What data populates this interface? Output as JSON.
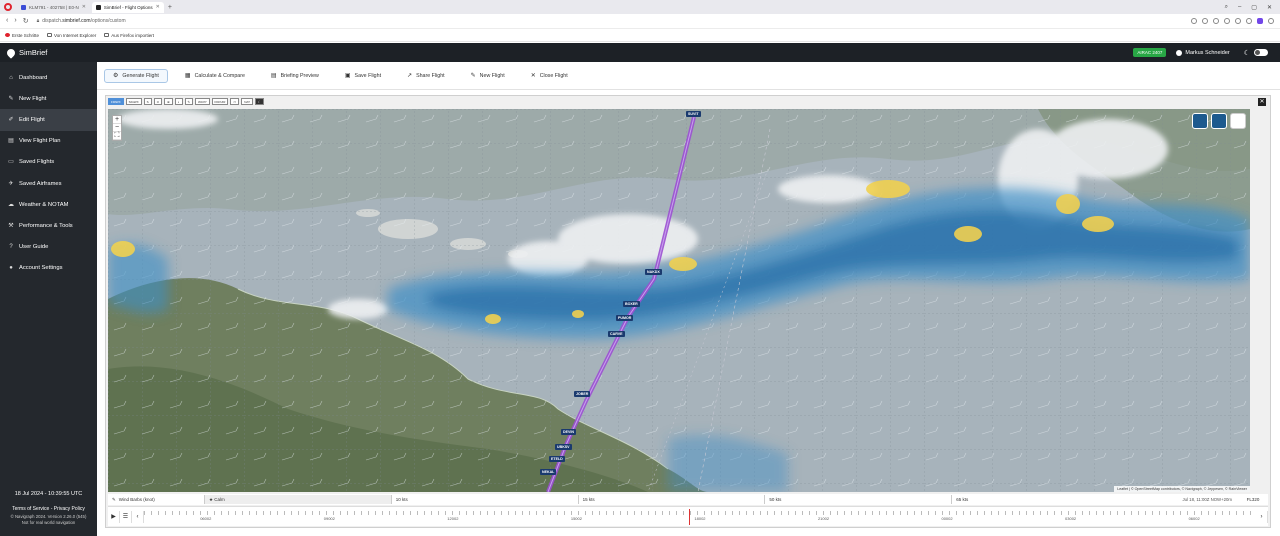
{
  "browser": {
    "tabs": [
      {
        "label": "KLM791 - 402758 | E0-N"
      },
      {
        "label": "SimBrief - Flight Options"
      }
    ],
    "url_prefix": "dispatch.",
    "url_domain": "simbrief.com",
    "url_path": "/options/custom",
    "bookmarks": [
      "Erste Schritte",
      "Von Internet Explorer",
      "Aus Firefox importiert"
    ]
  },
  "app": {
    "brand": "SimBrief",
    "airac": "AIRAC 2407",
    "user_name": "Markus Schneider"
  },
  "sidebar": {
    "items": [
      {
        "label": "Dashboard",
        "icon": "home-icon",
        "glyph": "⌂"
      },
      {
        "label": "New Flight",
        "icon": "pencil-icon",
        "glyph": "✎"
      },
      {
        "label": "Edit Flight",
        "icon": "edit-icon",
        "glyph": "✐"
      },
      {
        "label": "View Flight Plan",
        "icon": "document-icon",
        "glyph": "▤"
      },
      {
        "label": "Saved Flights",
        "icon": "folder-icon",
        "glyph": "▭"
      },
      {
        "label": "Saved Airframes",
        "icon": "plane-icon",
        "glyph": "✈"
      },
      {
        "label": "Weather & NOTAM",
        "icon": "cloud-icon",
        "glyph": "☁"
      },
      {
        "label": "Performance & Tools",
        "icon": "tools-icon",
        "glyph": "⚒"
      },
      {
        "label": "User Guide",
        "icon": "help-icon",
        "glyph": "?"
      },
      {
        "label": "Account Settings",
        "icon": "user-icon",
        "glyph": "●"
      }
    ],
    "date": "18 Jul 2024 - 10:39:55 UTC",
    "terms": "Terms of Service",
    "privacy": "Privacy Policy",
    "copyright": "© Navigraph 2024. Version 2.26.0 (545)",
    "notice": "Not for real world navigation"
  },
  "toolbar": {
    "buttons": [
      {
        "label": "Generate Flight",
        "icon": "gear-icon",
        "glyph": "⚙"
      },
      {
        "label": "Calculate & Compare",
        "icon": "calculator-icon",
        "glyph": "▦"
      },
      {
        "label": "Briefing Preview",
        "icon": "document-icon",
        "glyph": "▤"
      },
      {
        "label": "Save Flight",
        "icon": "save-icon",
        "glyph": "▣"
      },
      {
        "label": "Share Flight",
        "icon": "share-icon",
        "glyph": "↗"
      },
      {
        "label": "New Flight",
        "icon": "pencil-icon",
        "glyph": "✎"
      },
      {
        "label": "Close Flight",
        "icon": "close-icon",
        "glyph": "✕"
      }
    ]
  },
  "map": {
    "tools": [
      "FIRWX",
      "SIGWX",
      "S",
      "⊙",
      "⊕",
      "◐",
      "✎",
      "WAYP",
      "FIR/UIR",
      "▭",
      "NAT",
      "☾"
    ],
    "waypoints": [
      "SUVIT",
      "NAKDX",
      "BOXER",
      "PUMOR",
      "CARVE",
      "JOBER",
      "DEVIN",
      "UBKSV",
      "ETELD",
      "NEKAL"
    ],
    "attribution": "Leaflet | © OpenStreetMap contributors, © Navigraph, © Jeppesen, © RainViewer"
  },
  "legend": {
    "title": "Wind Barbs (knot)",
    "calm": "Calm",
    "ticks": [
      "10 kts",
      "15 kts",
      "50 kts",
      "65 kts"
    ],
    "time": "Jul 18, 11:00Z NOW+20m",
    "level": "FL320"
  },
  "timeline": {
    "labels": [
      "06002",
      "09002",
      "12002",
      "15002",
      "18002",
      "21002",
      "00002",
      "03002",
      "06002"
    ]
  },
  "colors": {
    "topbar": "#1d2126",
    "sidebar": "#24282d",
    "route": "#9b4fd1",
    "airac": "#28a745"
  }
}
